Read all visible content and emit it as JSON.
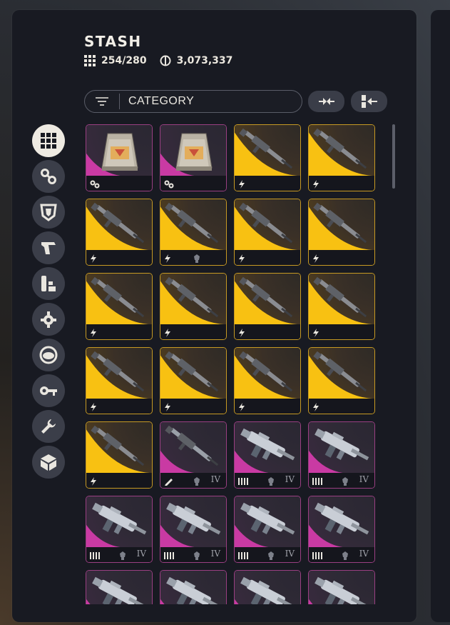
{
  "stash": {
    "title": "STASH",
    "capacity": "254/280",
    "currency": "3,073,337"
  },
  "filter": {
    "label": "CATEGORY"
  },
  "icons": {
    "capacity": "grid-icon",
    "currency": "coin-icon",
    "filter": "filter-lines-icon",
    "collapse": "collapse-arrows-icon",
    "sort": "sort-stack-icon"
  },
  "sidebar": {
    "categories": [
      {
        "name": "all",
        "icon": "grid-icon",
        "active": true
      },
      {
        "name": "materials",
        "icon": "gears-icon",
        "active": false
      },
      {
        "name": "armor",
        "icon": "shield-icon",
        "active": false
      },
      {
        "name": "weapons",
        "icon": "pistol-icon",
        "active": false
      },
      {
        "name": "ammo",
        "icon": "ammo-icon",
        "active": false
      },
      {
        "name": "mods",
        "icon": "gear-mod-icon",
        "active": false
      },
      {
        "name": "gadgets",
        "icon": "disc-icon",
        "active": false
      },
      {
        "name": "keys",
        "icon": "key-icon",
        "active": false
      },
      {
        "name": "tools",
        "icon": "wrench-icon",
        "active": false
      },
      {
        "name": "cosmetics",
        "icon": "cube-icon",
        "active": false
      }
    ]
  },
  "colors": {
    "gold": "#f8c112",
    "pink": "#c93aa3",
    "panel": "#181a22"
  },
  "items": [
    {
      "rarity": "pink",
      "kind": "crate",
      "b1": "gears",
      "b2": "",
      "tier": ""
    },
    {
      "rarity": "pink",
      "kind": "crate",
      "b1": "gears",
      "b2": "",
      "tier": ""
    },
    {
      "rarity": "gold",
      "kind": "rifle",
      "b1": "bolt",
      "b2": "",
      "tier": ""
    },
    {
      "rarity": "gold",
      "kind": "rifle",
      "b1": "bolt",
      "b2": "",
      "tier": ""
    },
    {
      "rarity": "gold",
      "kind": "rifle",
      "b1": "bolt",
      "b2": "",
      "tier": ""
    },
    {
      "rarity": "gold",
      "kind": "rifle",
      "b1": "bolt",
      "b2": "mod",
      "tier": ""
    },
    {
      "rarity": "gold",
      "kind": "rifle",
      "b1": "bolt",
      "b2": "",
      "tier": ""
    },
    {
      "rarity": "gold",
      "kind": "rifle",
      "b1": "bolt",
      "b2": "",
      "tier": ""
    },
    {
      "rarity": "gold",
      "kind": "rifle",
      "b1": "bolt",
      "b2": "",
      "tier": ""
    },
    {
      "rarity": "gold",
      "kind": "rifle",
      "b1": "bolt",
      "b2": "",
      "tier": ""
    },
    {
      "rarity": "gold",
      "kind": "rifle",
      "b1": "bolt",
      "b2": "",
      "tier": ""
    },
    {
      "rarity": "gold",
      "kind": "rifle",
      "b1": "bolt",
      "b2": "",
      "tier": ""
    },
    {
      "rarity": "gold",
      "kind": "rifle",
      "b1": "bolt",
      "b2": "",
      "tier": ""
    },
    {
      "rarity": "gold",
      "kind": "rifle",
      "b1": "bolt",
      "b2": "",
      "tier": ""
    },
    {
      "rarity": "gold",
      "kind": "rifle",
      "b1": "bolt",
      "b2": "",
      "tier": ""
    },
    {
      "rarity": "gold",
      "kind": "rifle",
      "b1": "bolt",
      "b2": "",
      "tier": ""
    },
    {
      "rarity": "gold",
      "kind": "rifle",
      "b1": "bolt",
      "b2": "",
      "tier": ""
    },
    {
      "rarity": "pink",
      "kind": "rifle",
      "b1": "pencil",
      "b2": "mod",
      "tier": "IV"
    },
    {
      "rarity": "pink",
      "kind": "smg",
      "b1": "ammo",
      "b2": "mod",
      "tier": "IV"
    },
    {
      "rarity": "pink",
      "kind": "smg",
      "b1": "ammo",
      "b2": "mod",
      "tier": "IV"
    },
    {
      "rarity": "pink",
      "kind": "smg",
      "b1": "ammo",
      "b2": "mod",
      "tier": "IV"
    },
    {
      "rarity": "pink",
      "kind": "smg",
      "b1": "ammo",
      "b2": "mod",
      "tier": "IV"
    },
    {
      "rarity": "pink",
      "kind": "smg",
      "b1": "ammo",
      "b2": "mod",
      "tier": "IV"
    },
    {
      "rarity": "pink",
      "kind": "smg",
      "b1": "ammo",
      "b2": "mod",
      "tier": "IV"
    },
    {
      "rarity": "pink",
      "kind": "smg",
      "b1": "",
      "b2": "",
      "tier": ""
    },
    {
      "rarity": "pink",
      "kind": "smg",
      "b1": "",
      "b2": "",
      "tier": ""
    },
    {
      "rarity": "pink",
      "kind": "smg",
      "b1": "",
      "b2": "",
      "tier": ""
    },
    {
      "rarity": "pink",
      "kind": "smg",
      "b1": "",
      "b2": "",
      "tier": ""
    }
  ]
}
